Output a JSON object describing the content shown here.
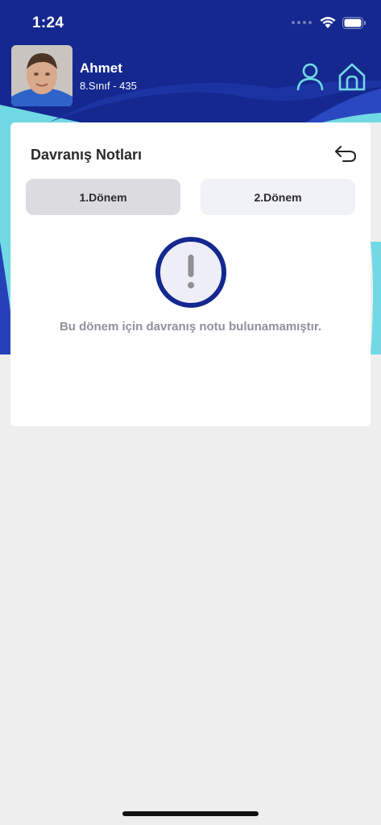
{
  "status_bar": {
    "time": "1:24"
  },
  "profile": {
    "name": "Ahmet",
    "class_info": "8.Sınıf - 435"
  },
  "icons": {
    "profile": "user-icon",
    "home": "home-icon",
    "back": "back-arrow-icon",
    "alert": "exclamation-icon"
  },
  "card": {
    "title": "Davranış Notları",
    "tabs": [
      {
        "label": "1.Dönem",
        "selected": true
      },
      {
        "label": "2.Dönem",
        "selected": false
      }
    ],
    "empty_message": "Bu dönem için davranış notu bulunamamıştır."
  },
  "colors": {
    "primary": "#14288f",
    "accent_blue": "#2641b8",
    "cyan": "#71d9e5",
    "background": "#eeeeee",
    "muted_text": "#8f919e"
  }
}
